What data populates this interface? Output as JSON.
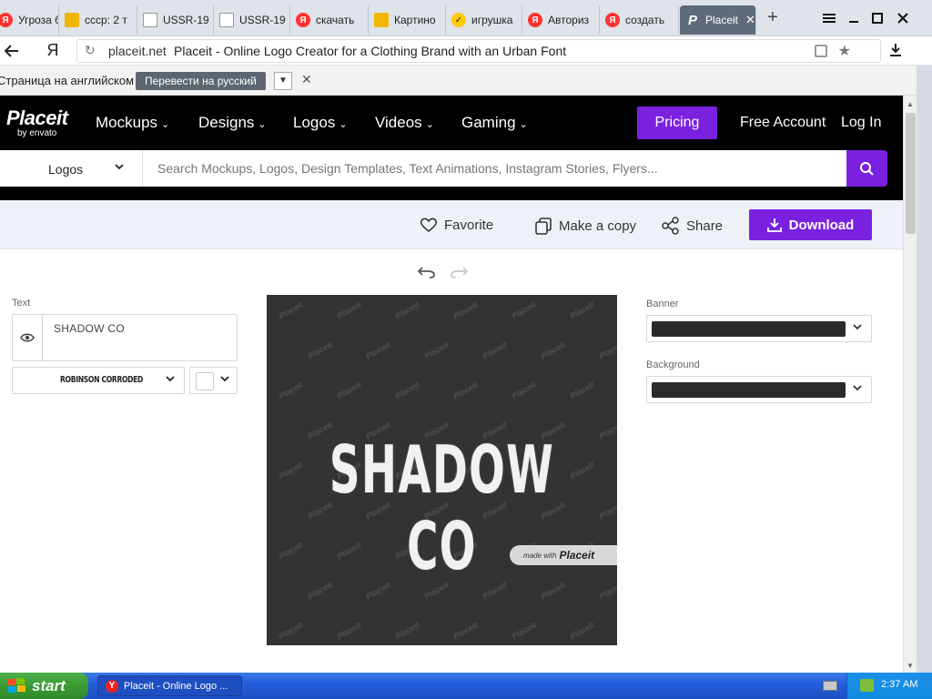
{
  "browser": {
    "tabs": [
      {
        "label": "Угроза б",
        "icon": "yandex-icon"
      },
      {
        "label": "ссср: 2 т",
        "icon": "image-icon"
      },
      {
        "label": "USSR-19",
        "icon": "document-icon"
      },
      {
        "label": "USSR-19",
        "icon": "document-icon"
      },
      {
        "label": "скачать",
        "icon": "yandex-icon"
      },
      {
        "label": "Картино",
        "icon": "image-icon"
      },
      {
        "label": "игрушка",
        "icon": "toy-icon"
      },
      {
        "label": "Авториз",
        "icon": "yandex-icon"
      },
      {
        "label": "создать",
        "icon": "yandex-icon"
      },
      {
        "label": "Placeit",
        "icon": "placeit-icon",
        "active": true
      }
    ],
    "tab_close": "✕",
    "new_tab": "+",
    "ya_button": "Я",
    "address": {
      "domain": "placeit.net",
      "page_title": "Placeit - Online Logo Creator for a Clothing Brand with an Urban Font"
    },
    "translate_bar": {
      "message": "Страница на английском",
      "translate_button": "Перевести на русский",
      "dropdown": "▼",
      "close": "✕"
    }
  },
  "site": {
    "logo": {
      "name": "Placeit",
      "byline": "by envato"
    },
    "nav": [
      {
        "label": "Mockups"
      },
      {
        "label": "Designs"
      },
      {
        "label": "Logos"
      },
      {
        "label": "Videos"
      },
      {
        "label": "Gaming"
      }
    ],
    "pricing": "Pricing",
    "free_account": "Free Account",
    "login": "Log In",
    "search": {
      "category": "Logos",
      "placeholder": "Search Mockups, Logos, Design Templates, Text Animations, Instagram Stories, Flyers..."
    },
    "actions": {
      "favorite": "Favorite",
      "copy": "Make a copy",
      "share": "Share",
      "download": "Download"
    }
  },
  "editor": {
    "text_label": "Text",
    "text_value": "SHADOW CO",
    "font": "ROBINSON CORRODED",
    "banner_label": "Banner",
    "background_label": "Background",
    "banner_color": "#2a2a2c",
    "background_color": "#2a2a2c",
    "canvas": {
      "logo_text": "SHADOW CO",
      "badge_prefix": "made with",
      "badge_brand": "Placeit",
      "watermark": "Placeit",
      "background": "#333335"
    }
  },
  "taskbar": {
    "start": "start",
    "window": "Placeit - Online Logo ...",
    "clock": "2:37 AM"
  },
  "colors": {
    "accent": "#7a21e0",
    "nav_bg": "#000000",
    "action_bar_bg": "#eef2f8"
  }
}
